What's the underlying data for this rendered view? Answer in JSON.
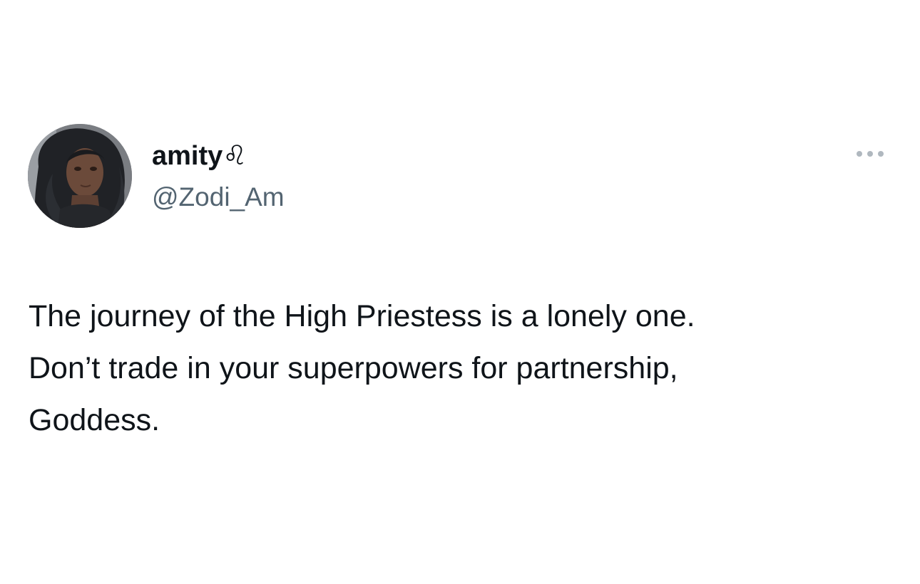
{
  "tweet": {
    "author": {
      "display_name": "amity♌",
      "handle": "@Zodi_Am",
      "avatar_icon": "profile-photo"
    },
    "more_icon": "more-horizontal-icon",
    "text_lines": [
      "The journey of the High Priestess is a lonely one.",
      "Don’t trade in your superpowers for partnership,",
      "Goddess."
    ]
  },
  "colors": {
    "background": "#ffffff",
    "text_primary": "#0f1419",
    "text_secondary": "#536471",
    "more_dots": "#b0b8bf"
  }
}
